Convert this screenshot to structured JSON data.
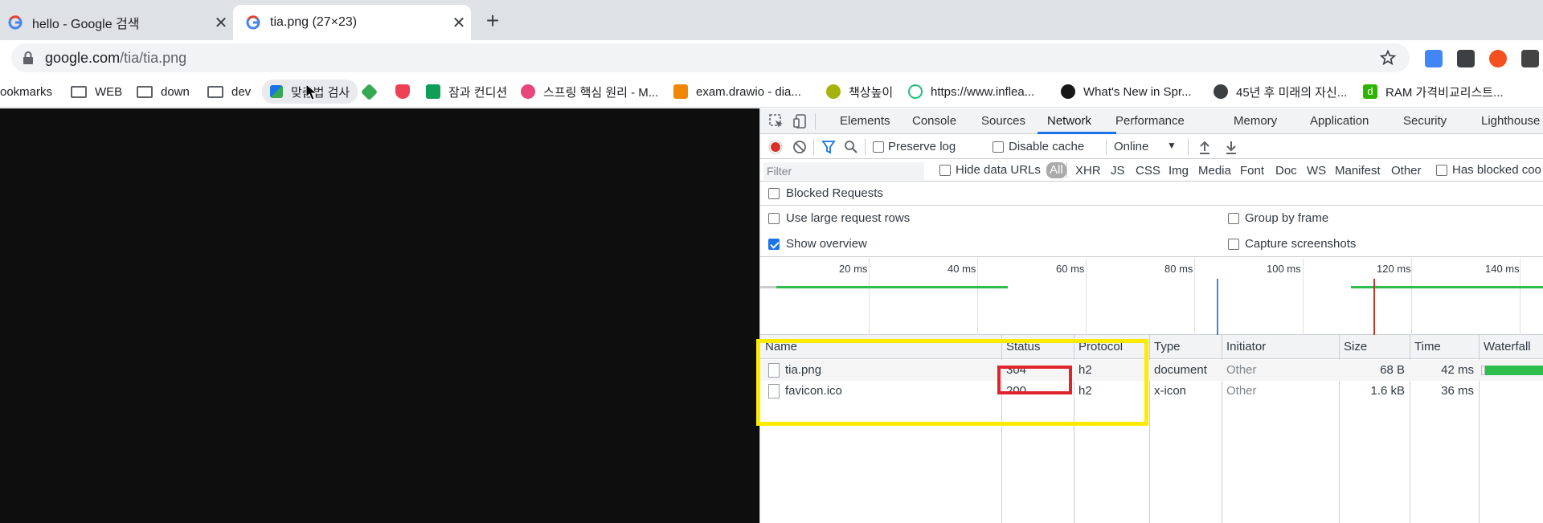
{
  "tabs": [
    {
      "title": "hello - Google 검색",
      "active": false
    },
    {
      "title": "tia.png (27×23)",
      "active": true
    }
  ],
  "omnibox": {
    "domain": "google.com",
    "path": "/tia/tia.png"
  },
  "bookmarks": [
    {
      "label": "ookmarks",
      "icon": "bookmarks-label"
    },
    {
      "label": "WEB",
      "icon": "folder-icon"
    },
    {
      "label": "down",
      "icon": "folder-icon"
    },
    {
      "label": "dev",
      "icon": "folder-icon"
    },
    {
      "label": "맞춤법 검사",
      "icon": "spellcheck-icon"
    },
    {
      "label": "",
      "icon": "green-diamond-icon"
    },
    {
      "label": "",
      "icon": "pocket-icon"
    },
    {
      "label": "잠과 컨디션",
      "icon": "sheets-icon"
    },
    {
      "label": "스프링 핵심 원리 - M...",
      "icon": "course-icon"
    },
    {
      "label": "exam.drawio - dia...",
      "icon": "drawio-icon"
    },
    {
      "label": "책상높이",
      "icon": "desk-icon"
    },
    {
      "label": "https://www.inflea...",
      "icon": "inflearn-icon"
    },
    {
      "label": "What's New in Spr...",
      "icon": "github-icon"
    },
    {
      "label": "45년 후 미래의 자신...",
      "icon": "globe-icon"
    },
    {
      "label": "RAM 가격비교리스트...",
      "icon": "d-icon"
    }
  ],
  "devtools": {
    "tabs": [
      "Elements",
      "Console",
      "Sources",
      "Network",
      "Performance",
      "Memory",
      "Application",
      "Security",
      "Lighthouse"
    ],
    "selected_tab": "Network",
    "toolbar": {
      "preserve_log": "Preserve log",
      "disable_cache": "Disable cache",
      "throttle": "Online"
    },
    "filter": {
      "placeholder": "Filter",
      "hide_data_urls": "Hide data URLs",
      "types": [
        "All",
        "XHR",
        "JS",
        "CSS",
        "Img",
        "Media",
        "Font",
        "Doc",
        "WS",
        "Manifest",
        "Other"
      ],
      "has_blocked": "Has blocked coo"
    },
    "blocked_requests": "Blocked Requests",
    "settings": {
      "large_rows": "Use large request rows",
      "group_by_frame": "Group by frame",
      "show_overview": "Show overview",
      "capture_screenshots": "Capture screenshots"
    },
    "overview_ticks": [
      "20 ms",
      "40 ms",
      "60 ms",
      "80 ms",
      "100 ms",
      "120 ms",
      "140 ms"
    ],
    "table": {
      "headers": [
        "Name",
        "Status",
        "Protocol",
        "Type",
        "Initiator",
        "Size",
        "Time",
        "Waterfall"
      ],
      "rows": [
        {
          "name": "tia.png",
          "status": "304",
          "protocol": "h2",
          "type": "document",
          "initiator": "Other",
          "size": "68 B",
          "time": "42 ms"
        },
        {
          "name": "favicon.ico",
          "status": "200",
          "protocol": "h2",
          "type": "x-icon",
          "initiator": "Other",
          "size": "1.6 kB",
          "time": "36 ms"
        }
      ]
    }
  },
  "colors": {
    "highlight_yellow": "#ffeb00",
    "highlight_red": "#e0242c",
    "accent": "#1a73e8",
    "record_red": "#d93025"
  }
}
